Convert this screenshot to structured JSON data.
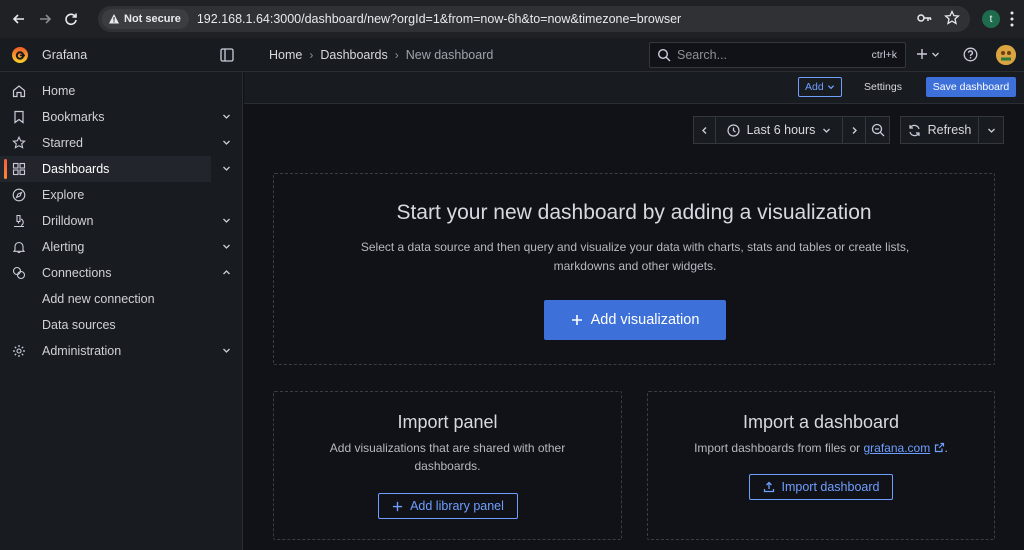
{
  "browser": {
    "security_label": "Not secure",
    "url": "192.168.1.64:3000/dashboard/new?orgId=1&from=now-6h&to=now&timezone=browser",
    "profile_initial": "t"
  },
  "topbar": {
    "app_title": "Grafana",
    "breadcrumbs": [
      "Home",
      "Dashboards",
      "New dashboard"
    ],
    "search_placeholder": "Search...",
    "search_shortcut": "ctrl+k"
  },
  "sidebar": {
    "items": [
      {
        "label": "Home",
        "icon": "home-icon",
        "chevron": false
      },
      {
        "label": "Bookmarks",
        "icon": "bookmark-icon",
        "chevron": "down"
      },
      {
        "label": "Starred",
        "icon": "star-icon",
        "chevron": "down"
      },
      {
        "label": "Dashboards",
        "icon": "apps-icon",
        "chevron": "down",
        "active": true
      },
      {
        "label": "Explore",
        "icon": "compass-icon",
        "chevron": false
      },
      {
        "label": "Drilldown",
        "icon": "microscope-icon",
        "chevron": "down"
      },
      {
        "label": "Alerting",
        "icon": "bell-icon",
        "chevron": "down"
      },
      {
        "label": "Connections",
        "icon": "connections-icon",
        "chevron": "up"
      },
      {
        "label": "Add new connection",
        "sub": true
      },
      {
        "label": "Data sources",
        "sub": true
      },
      {
        "label": "Administration",
        "icon": "cog-icon",
        "chevron": "down"
      }
    ]
  },
  "toolbar": {
    "add_label": "Add",
    "settings_label": "Settings",
    "save_label": "Save dashboard"
  },
  "time_controls": {
    "range_label": "Last 6 hours",
    "refresh_label": "Refresh"
  },
  "empty_state": {
    "title": "Start your new dashboard by adding a visualization",
    "description": "Select a data source and then query and visualize your data with charts, stats and tables or create lists, markdowns and other widgets.",
    "button_label": "Add visualization"
  },
  "import_panel": {
    "title": "Import panel",
    "description": "Add visualizations that are shared with other dashboards.",
    "button_label": "Add library panel"
  },
  "import_dashboard": {
    "title": "Import a dashboard",
    "description_prefix": "Import dashboards from files or ",
    "link_text": "grafana.com",
    "description_suffix": ".",
    "button_label": "Import dashboard"
  },
  "colors": {
    "accent": "#3d71d9",
    "link": "#6e9fff",
    "active_indicator": "#f55f3e"
  }
}
